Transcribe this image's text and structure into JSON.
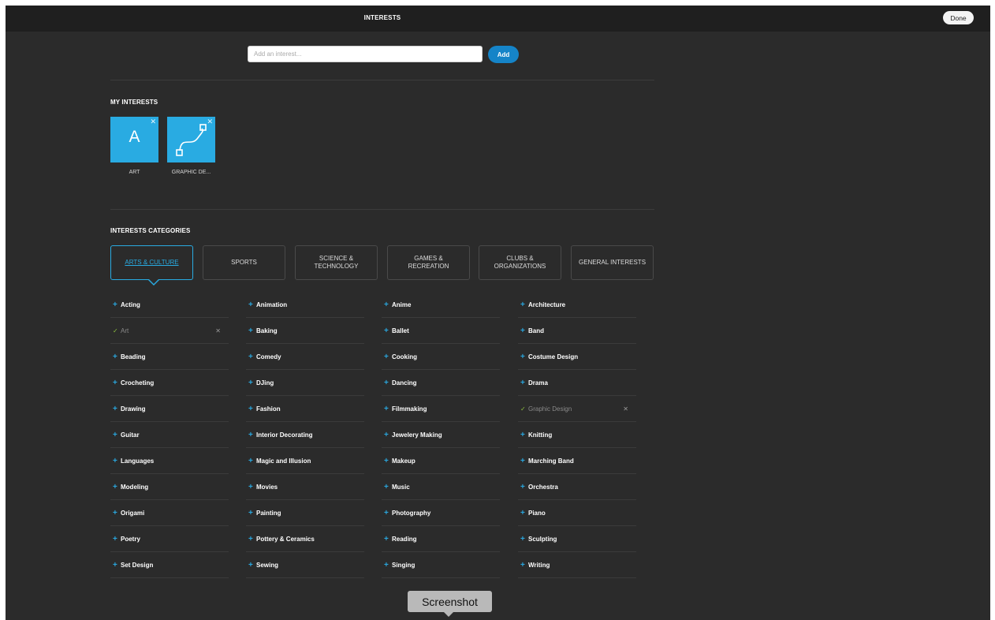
{
  "header": {
    "title": "INTERESTS",
    "done_label": "Done"
  },
  "search": {
    "placeholder": "Add an interest...",
    "add_label": "Add"
  },
  "my_interests": {
    "title": "MY INTERESTS",
    "tiles": [
      {
        "label": "ART",
        "icon": "letter-a-icon",
        "glyph": "A"
      },
      {
        "label": "GRAPHIC DE...",
        "icon": "bezier-path-icon"
      }
    ]
  },
  "categories": {
    "title": "INTERESTS CATEGORIES",
    "tabs": [
      {
        "label": "ARTS & CULTURE",
        "active": true
      },
      {
        "label": "SPORTS"
      },
      {
        "label": "SCIENCE &\nTECHNOLOGY"
      },
      {
        "label": "GAMES &\nRECREATION"
      },
      {
        "label": "CLUBS &\nORGANIZATIONS"
      },
      {
        "label": "GENERAL INTERESTS"
      }
    ],
    "columns": [
      [
        {
          "label": "Acting"
        },
        {
          "label": "Art",
          "selected": true
        },
        {
          "label": "Beading"
        },
        {
          "label": "Crocheting"
        },
        {
          "label": "Drawing"
        },
        {
          "label": "Guitar"
        },
        {
          "label": "Languages"
        },
        {
          "label": "Modeling"
        },
        {
          "label": "Origami"
        },
        {
          "label": "Poetry"
        },
        {
          "label": "Set Design"
        }
      ],
      [
        {
          "label": "Animation"
        },
        {
          "label": "Baking"
        },
        {
          "label": "Comedy"
        },
        {
          "label": "DJing"
        },
        {
          "label": "Fashion"
        },
        {
          "label": "Interior Decorating"
        },
        {
          "label": "Magic and Illusion"
        },
        {
          "label": "Movies"
        },
        {
          "label": "Painting"
        },
        {
          "label": "Pottery & Ceramics"
        },
        {
          "label": "Sewing"
        }
      ],
      [
        {
          "label": "Anime"
        },
        {
          "label": "Ballet"
        },
        {
          "label": "Cooking"
        },
        {
          "label": "Dancing"
        },
        {
          "label": "Filmmaking"
        },
        {
          "label": "Jewelery Making"
        },
        {
          "label": "Makeup"
        },
        {
          "label": "Music"
        },
        {
          "label": "Photography"
        },
        {
          "label": "Reading"
        },
        {
          "label": "Singing"
        }
      ],
      [
        {
          "label": "Architecture"
        },
        {
          "label": "Band"
        },
        {
          "label": "Costume Design"
        },
        {
          "label": "Drama"
        },
        {
          "label": "Graphic Design",
          "selected": true
        },
        {
          "label": "Knitting"
        },
        {
          "label": "Marching Band"
        },
        {
          "label": "Orchestra"
        },
        {
          "label": "Piano"
        },
        {
          "label": "Sculpting"
        },
        {
          "label": "Writing"
        }
      ]
    ]
  },
  "tooltip": {
    "label": "Screenshot"
  },
  "colors": {
    "accent": "#29abe2",
    "add_button": "#1584c8",
    "background": "#2b2b2b",
    "topbar": "#1f1f1f",
    "check": "#8bbf3d"
  }
}
